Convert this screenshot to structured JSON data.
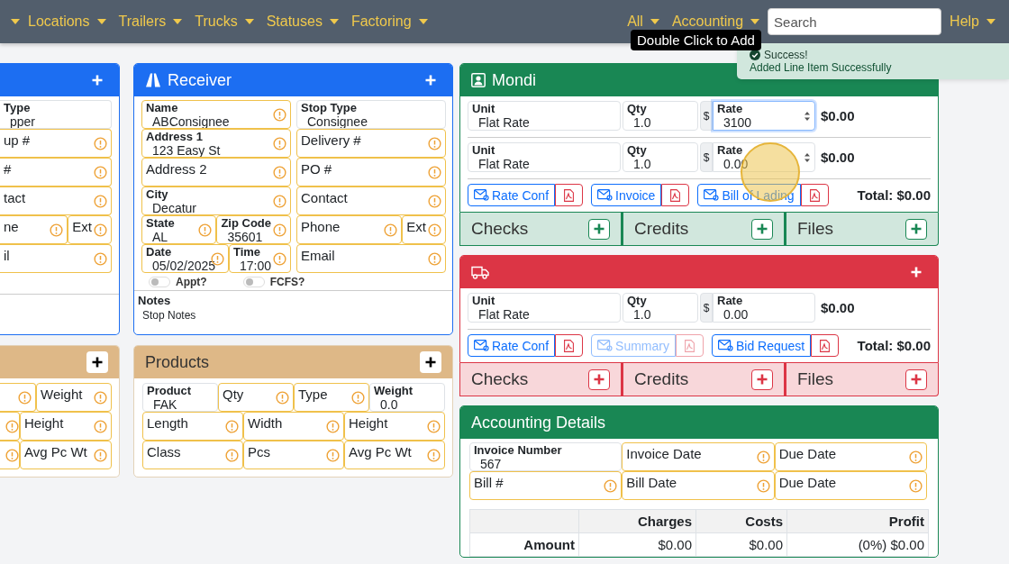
{
  "nav": {
    "menus": [
      {
        "label": "Locations"
      },
      {
        "label": "Trailers"
      },
      {
        "label": "Trucks"
      },
      {
        "label": "Statuses"
      },
      {
        "label": "Factoring"
      }
    ],
    "right_menus": [
      {
        "label": "All"
      },
      {
        "label": "Accounting"
      }
    ],
    "search": {
      "placeholder": "Search"
    },
    "help": {
      "label": "Help"
    }
  },
  "tooltip": {
    "text": "Double Click to Add"
  },
  "toast": {
    "title": "Success!",
    "message": "Added Line Item Successfully"
  },
  "shipper_partial": {
    "rows": [
      [
        [
          {
            "label": "Type",
            "value": "pper",
            "warning": false
          }
        ]
      ],
      [
        [
          {
            "label": "up #",
            "warning": true
          }
        ]
      ],
      [
        [
          {
            "label": "#",
            "warning": true
          }
        ]
      ],
      [
        [
          {
            "label": "tact",
            "warning": true
          }
        ]
      ],
      [
        [
          {
            "label": "ne",
            "warning": true
          },
          {
            "label": "Ext",
            "warning": true
          }
        ]
      ],
      [
        [
          {
            "label": "il",
            "warning": true
          }
        ]
      ]
    ]
  },
  "receiver": {
    "title": "Receiver",
    "rows": [
      [
        [
          {
            "label": "Name",
            "value": "ABConsignee",
            "warning": true
          }
        ],
        [
          {
            "label": "Stop Type",
            "value": "Consignee",
            "warning": false
          }
        ]
      ],
      [
        [
          {
            "label": "Address 1",
            "value": "123 Easy St",
            "warning": true
          }
        ],
        [
          {
            "label": "Delivery #",
            "warning": true
          }
        ]
      ],
      [
        [
          {
            "label": "Address 2",
            "warning": true
          }
        ],
        [
          {
            "label": "PO #",
            "warning": true
          }
        ]
      ],
      [
        [
          {
            "label": "City",
            "value": "Decatur",
            "warning": true
          }
        ],
        [
          {
            "label": "Contact",
            "warning": true
          }
        ]
      ],
      [
        [
          {
            "label": "State",
            "value": "AL",
            "warning": true
          },
          {
            "label": "Zip Code",
            "value": "35601",
            "warning": true
          }
        ],
        [
          {
            "label": "Phone",
            "warning": true
          },
          {
            "label": "Ext",
            "warning": true
          }
        ]
      ],
      [
        [
          {
            "label": "Date",
            "value": "05/02/2025",
            "warning": true
          },
          {
            "label": "Time",
            "value": "17:00",
            "warning": true
          }
        ],
        [
          {
            "label": "Email",
            "warning": true
          }
        ]
      ]
    ],
    "toggles": [
      {
        "label": "Appt?",
        "on": false
      },
      {
        "label": "FCFS?",
        "on": false
      }
    ],
    "notes": {
      "label": "Notes",
      "value": "Stop Notes"
    }
  },
  "products_partial": {
    "rows": [
      [
        [
          {
            "warning": true
          }
        ],
        [
          {
            "label": "Weight",
            "warning": true
          }
        ]
      ],
      [
        [
          {
            "warning": true
          }
        ],
        [
          {
            "label": "Height",
            "warning": true
          }
        ]
      ],
      [
        [
          {
            "warning": true
          }
        ],
        [
          {
            "label": "Avg Pc Wt",
            "warning": true
          }
        ]
      ]
    ]
  },
  "products": {
    "title": "Products",
    "rows": [
      [
        [
          {
            "label": "Product",
            "value": "FAK",
            "warning": false
          }
        ],
        [
          {
            "label": "Qty",
            "warning": true
          }
        ],
        [
          {
            "label": "Type",
            "warning": true
          }
        ],
        [
          {
            "label": "Weight",
            "value": "0.0",
            "warning": false
          }
        ]
      ],
      [
        [
          {
            "label": "Length",
            "warning": true
          }
        ],
        [
          {
            "label": "Width",
            "warning": true
          }
        ],
        [
          {
            "label": "Height",
            "warning": true
          }
        ]
      ],
      [
        [
          {
            "label": "Class",
            "warning": true
          }
        ],
        [
          {
            "label": "Pcs",
            "warning": true
          }
        ],
        [
          {
            "label": "Avg Pc Wt",
            "warning": true
          }
        ]
      ]
    ]
  },
  "charge_groups": [
    {
      "kind": "carrier",
      "title": "Mondi",
      "line_items": [
        {
          "unit": {
            "label": "Unit",
            "value": "Flat Rate"
          },
          "qty": {
            "label": "Qty",
            "value": "1.0"
          },
          "currency": "$",
          "rate": {
            "label": "Rate",
            "value": "3100",
            "focused": true,
            "spinner": true
          },
          "amount": "$0.00"
        },
        {
          "unit": {
            "label": "Unit",
            "value": "Flat Rate"
          },
          "qty": {
            "label": "Qty",
            "value": "1.0"
          },
          "currency": "$",
          "rate": {
            "label": "Rate",
            "value": "0.00",
            "focused": false,
            "spinner": true
          },
          "amount": "$0.00"
        }
      ],
      "documents": [
        {
          "label": "Rate Conf",
          "disabled": false
        },
        {
          "label": "Invoice",
          "disabled": false
        },
        {
          "label": "Bill of Lading",
          "disabled": false
        }
      ],
      "total": "Total: $0.00",
      "sections": [
        {
          "label": "Checks"
        },
        {
          "label": "Credits"
        },
        {
          "label": "Files"
        }
      ]
    },
    {
      "kind": "truck",
      "line_items": [
        {
          "unit": {
            "label": "Unit",
            "value": "Flat Rate"
          },
          "qty": {
            "label": "Qty",
            "value": "1.0"
          },
          "currency": "$",
          "rate": {
            "label": "Rate",
            "value": "0.00",
            "focused": false
          },
          "amount": "$0.00"
        }
      ],
      "documents": [
        {
          "label": "Rate Conf",
          "disabled": false
        },
        {
          "label": "Summary",
          "disabled": true
        },
        {
          "label": "Bid Request",
          "disabled": false
        }
      ],
      "total": "Total: $0.00",
      "sections": [
        {
          "label": "Checks"
        },
        {
          "label": "Credits"
        },
        {
          "label": "Files"
        }
      ]
    }
  ],
  "accounting": {
    "title": "Accounting Details",
    "rows": [
      [
        [
          {
            "label": "Invoice Number",
            "value": "567",
            "warning": false
          }
        ],
        [
          {
            "label": "Invoice Date",
            "warning": true
          }
        ],
        [
          {
            "label": "Due Date",
            "warning": true
          }
        ]
      ],
      [
        [
          {
            "label": "Bill #",
            "warning": true
          }
        ],
        [
          {
            "label": "Bill Date",
            "warning": true
          }
        ],
        [
          {
            "label": "Due Date",
            "warning": true
          }
        ]
      ]
    ],
    "table": {
      "columns": [
        "Charges",
        "Costs",
        "Profit"
      ],
      "rows": [
        {
          "label": "Amount",
          "cells": [
            "$0.00",
            "$0.00",
            "(0%) $0.00"
          ]
        }
      ]
    }
  }
}
